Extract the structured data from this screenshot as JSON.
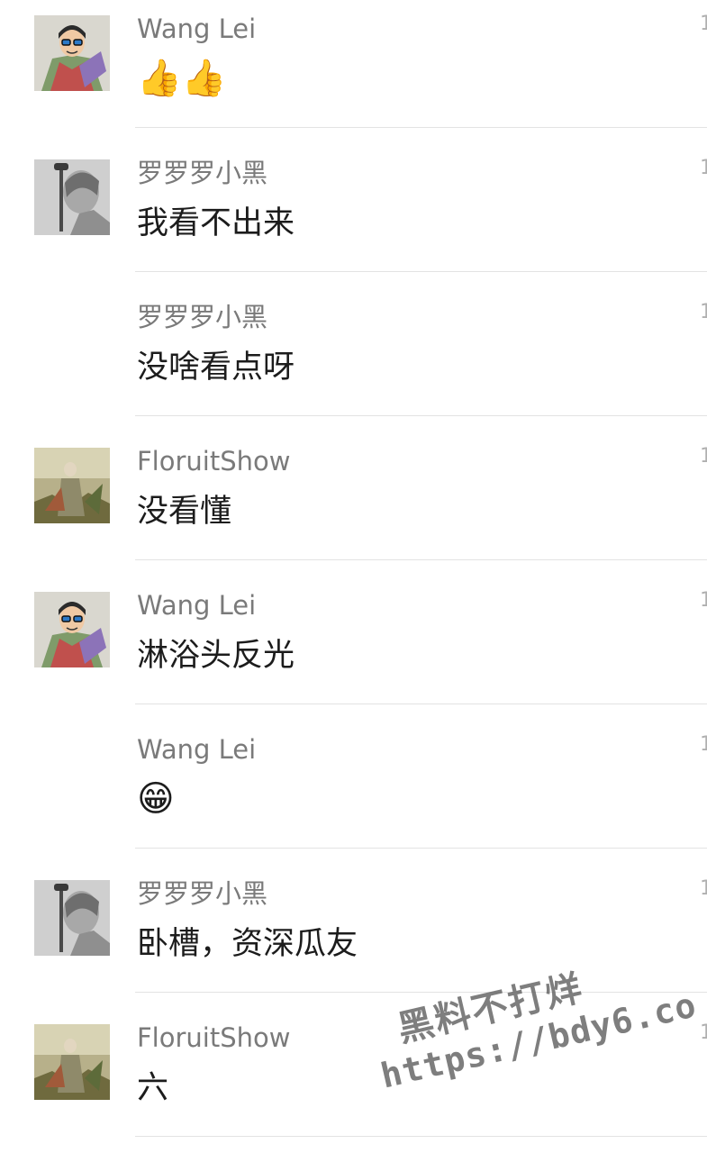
{
  "comments": [
    {
      "avatar": "wang-lei-avatar",
      "name": "Wang Lei",
      "text": "👍👍",
      "time": "1"
    },
    {
      "avatar": "luoluoluo-avatar",
      "name": "罗罗罗小黑",
      "text": "我看不出来",
      "time": "1"
    },
    {
      "avatar": "",
      "name": "罗罗罗小黑",
      "text": "没啥看点呀",
      "time": "1"
    },
    {
      "avatar": "floruitshow-avatar",
      "name": "FloruitShow",
      "text": "没看懂",
      "time": "1"
    },
    {
      "avatar": "wang-lei-avatar",
      "name": "Wang Lei",
      "text": "淋浴头反光",
      "time": "1"
    },
    {
      "avatar": "",
      "name": "Wang Lei",
      "text": "😁",
      "time": "1"
    },
    {
      "avatar": "luoluoluo-avatar",
      "name": "罗罗罗小黑",
      "text": "卧槽，资深瓜友",
      "time": "1"
    },
    {
      "avatar": "floruitshow-avatar",
      "name": "FloruitShow",
      "text": "六",
      "time": "1"
    }
  ],
  "watermark": {
    "line1": "黑料不打烊",
    "line2": "https://bdy6.co"
  }
}
